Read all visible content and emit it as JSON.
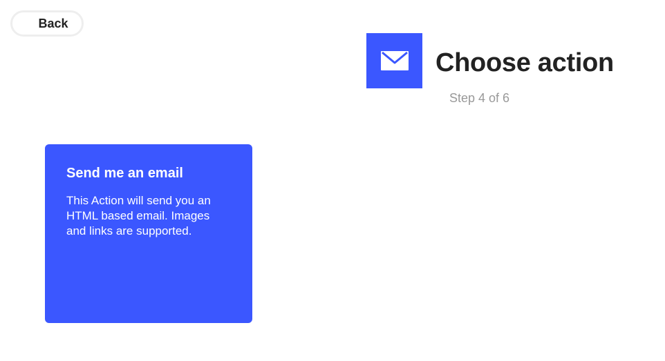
{
  "header": {
    "back_label": "Back",
    "title": "Choose action",
    "step_text": "Step 4 of 6"
  },
  "service": {
    "icon": "envelope-icon",
    "color": "#3b57ff"
  },
  "actions": [
    {
      "title": "Send me an email",
      "description": "This Action will send you an HTML based email. Images and links are supported.",
      "color": "#3b57ff"
    }
  ]
}
